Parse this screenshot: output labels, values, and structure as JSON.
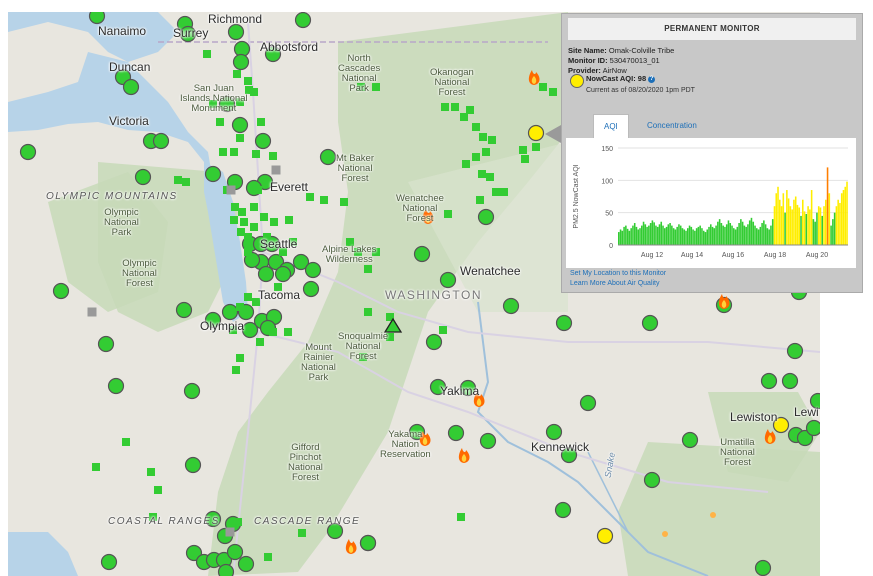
{
  "map": {
    "places": [
      "Nanaimo",
      "Surrey",
      "Richmond",
      "Abbotsford",
      "Duncan",
      "San Juan\nIslands National\nMonument",
      "Victoria",
      "North\nCascades\nNational\nPark",
      "Okanogan\nNational\nForest",
      "Mt Baker\nNational\nForest",
      "Everett",
      "OLYMPIC MOUNTAINS",
      "Olympic\nNational\nPark",
      "Olympic\nNational\nForest",
      "Wenatchee\nNational\nForest",
      "Seattle",
      "Alpine Lakes\nWilderness",
      "Wenatchee",
      "WASHINGTON",
      "Tacoma",
      "Olympia",
      "Snoqualmie\nNational\nForest",
      "Mount\nRainier\nNational\nPark",
      "Yakima",
      "Yakama\nNation\nReservation",
      "Kennewick",
      "Gifford\nPinchot\nNational\nForest",
      "Lewiston",
      "Lewi",
      "Umatilla\nNational\nForest",
      "COASTAL RANGES",
      "CASCADE RANGE",
      "Snake"
    ],
    "colors": {
      "good": "#33cc33",
      "moderate": "#ffee00",
      "nodata": "#999999",
      "fire": "#ff6a00",
      "land": "#e8e6df",
      "forest": "#c7d9b8",
      "water": "#b7d3e8"
    }
  },
  "panel": {
    "title": "PERMANENT MONITOR",
    "site_label": "Site Name:",
    "site_value": "Omak-Colville Tribe",
    "monitor_label": "Monitor ID:",
    "monitor_value": "530470013_01",
    "provider_label": "Provider:",
    "provider_value": "AirNow",
    "nowcast_label": "NowCast AQI: 98",
    "help_icon": "question-circle-icon",
    "current_as_of": "Current as of 08/20/2020 1pm PDT",
    "tabs": [
      "AQI",
      "Concentration"
    ],
    "active_tab": "AQI",
    "links": [
      "Set My Location to this Monitor",
      "Learn More About Air Quality"
    ]
  },
  "chart_data": {
    "type": "bar",
    "ylabel": "PM2.5 NowCast AQI",
    "ylim": [
      0,
      150
    ],
    "yticks": [
      0,
      50,
      100,
      150
    ],
    "xticks": [
      "Aug 12",
      "Aug 14",
      "Aug 16",
      "Aug 18",
      "Aug 20"
    ],
    "grid": true,
    "series": [
      {
        "values": [
          20,
          24,
          22,
          28,
          30,
          25,
          22,
          26,
          30,
          34,
          28,
          24,
          26,
          30,
          36,
          32,
          28,
          30,
          34,
          38,
          35,
          30,
          28,
          32,
          36,
          30,
          26,
          28,
          32,
          34,
          30,
          26,
          24,
          28,
          32,
          30,
          26,
          24,
          22,
          26,
          30,
          28,
          24,
          22,
          26,
          28,
          30,
          26,
          22,
          20,
          24,
          28,
          32,
          28,
          26,
          30,
          36,
          40,
          34,
          30,
          28,
          32,
          38,
          34,
          30,
          26,
          24,
          28,
          34,
          40,
          36,
          30,
          28,
          32,
          38,
          42,
          36,
          30,
          26,
          24,
          28,
          34,
          38,
          32,
          26,
          24,
          30,
          40,
          60,
          80,
          90,
          70,
          60,
          80,
          50,
          85,
          72,
          60,
          55,
          70,
          75,
          62,
          58,
          45,
          70,
          52,
          48,
          60,
          55,
          85,
          40,
          36,
          50,
          60,
          58,
          45,
          60,
          70,
          120,
          80,
          30,
          40,
          50,
          60,
          70,
          65,
          80,
          85,
          90,
          98
        ],
        "color_by_value": true
      }
    ]
  }
}
